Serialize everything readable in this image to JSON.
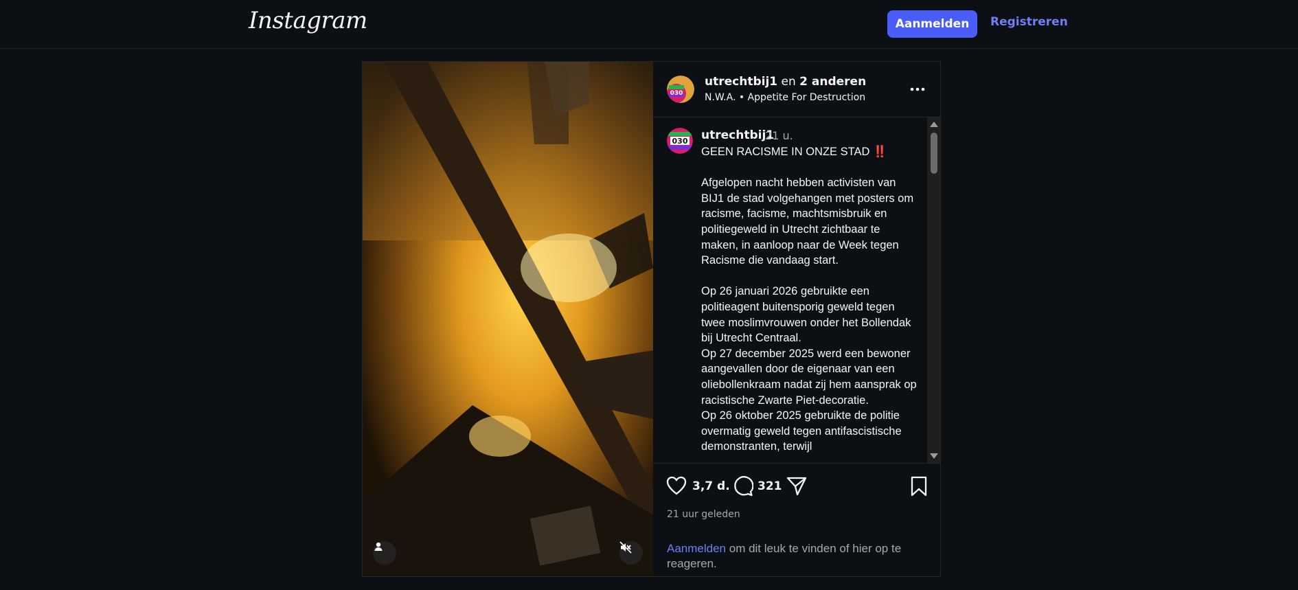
{
  "header": {
    "logo_text": "Instagram",
    "login_button": "Aanmelden",
    "register_link": "Registreren",
    "accent_color": "#4a5df9"
  },
  "media": {
    "user_icon": "person-icon",
    "mute_icon": "speaker-muted-icon"
  },
  "post_header": {
    "author": "utrechtbij1",
    "connector": " en ",
    "others": "2 anderen",
    "audio": "N.W.A. • Appetite For Destruction",
    "more_icon": "more-horizontal-icon",
    "avatar_text": "030"
  },
  "caption": {
    "author": "utrechtbij1",
    "time": "21 u.",
    "title": "GEEN RACISME IN ONZE STAD ‼️",
    "body": "Afgelopen nacht hebben activisten van BIJ1 de stad volgehangen met posters om racisme, facisme, machtsmisbruik en politiegeweld in Utrecht zichtbaar te maken, in aanloop naar de Week tegen Racisme die vandaag start.\n\nOp 26 januari 2026 gebruikte een politieagent buitensporig geweld tegen twee moslimvrouwen onder het Bollendak bij Utrecht Centraal.\nOp 27 december 2025 werd een bewoner aangevallen door de eigenaar van een oliebollenkraam nadat zij hem aansprak op racistische Zwarte Piet-decoratie.\nOp 26 oktober 2025 gebruikte de politie overmatig geweld tegen antifascistische demonstranten, terwijl"
  },
  "actions": {
    "likes": "3,7 d.",
    "comments": "321",
    "timestamp": "21 uur geleden",
    "login_link": "Aanmelden",
    "login_rest": " om dit leuk te vinden of hier op te reageren."
  }
}
